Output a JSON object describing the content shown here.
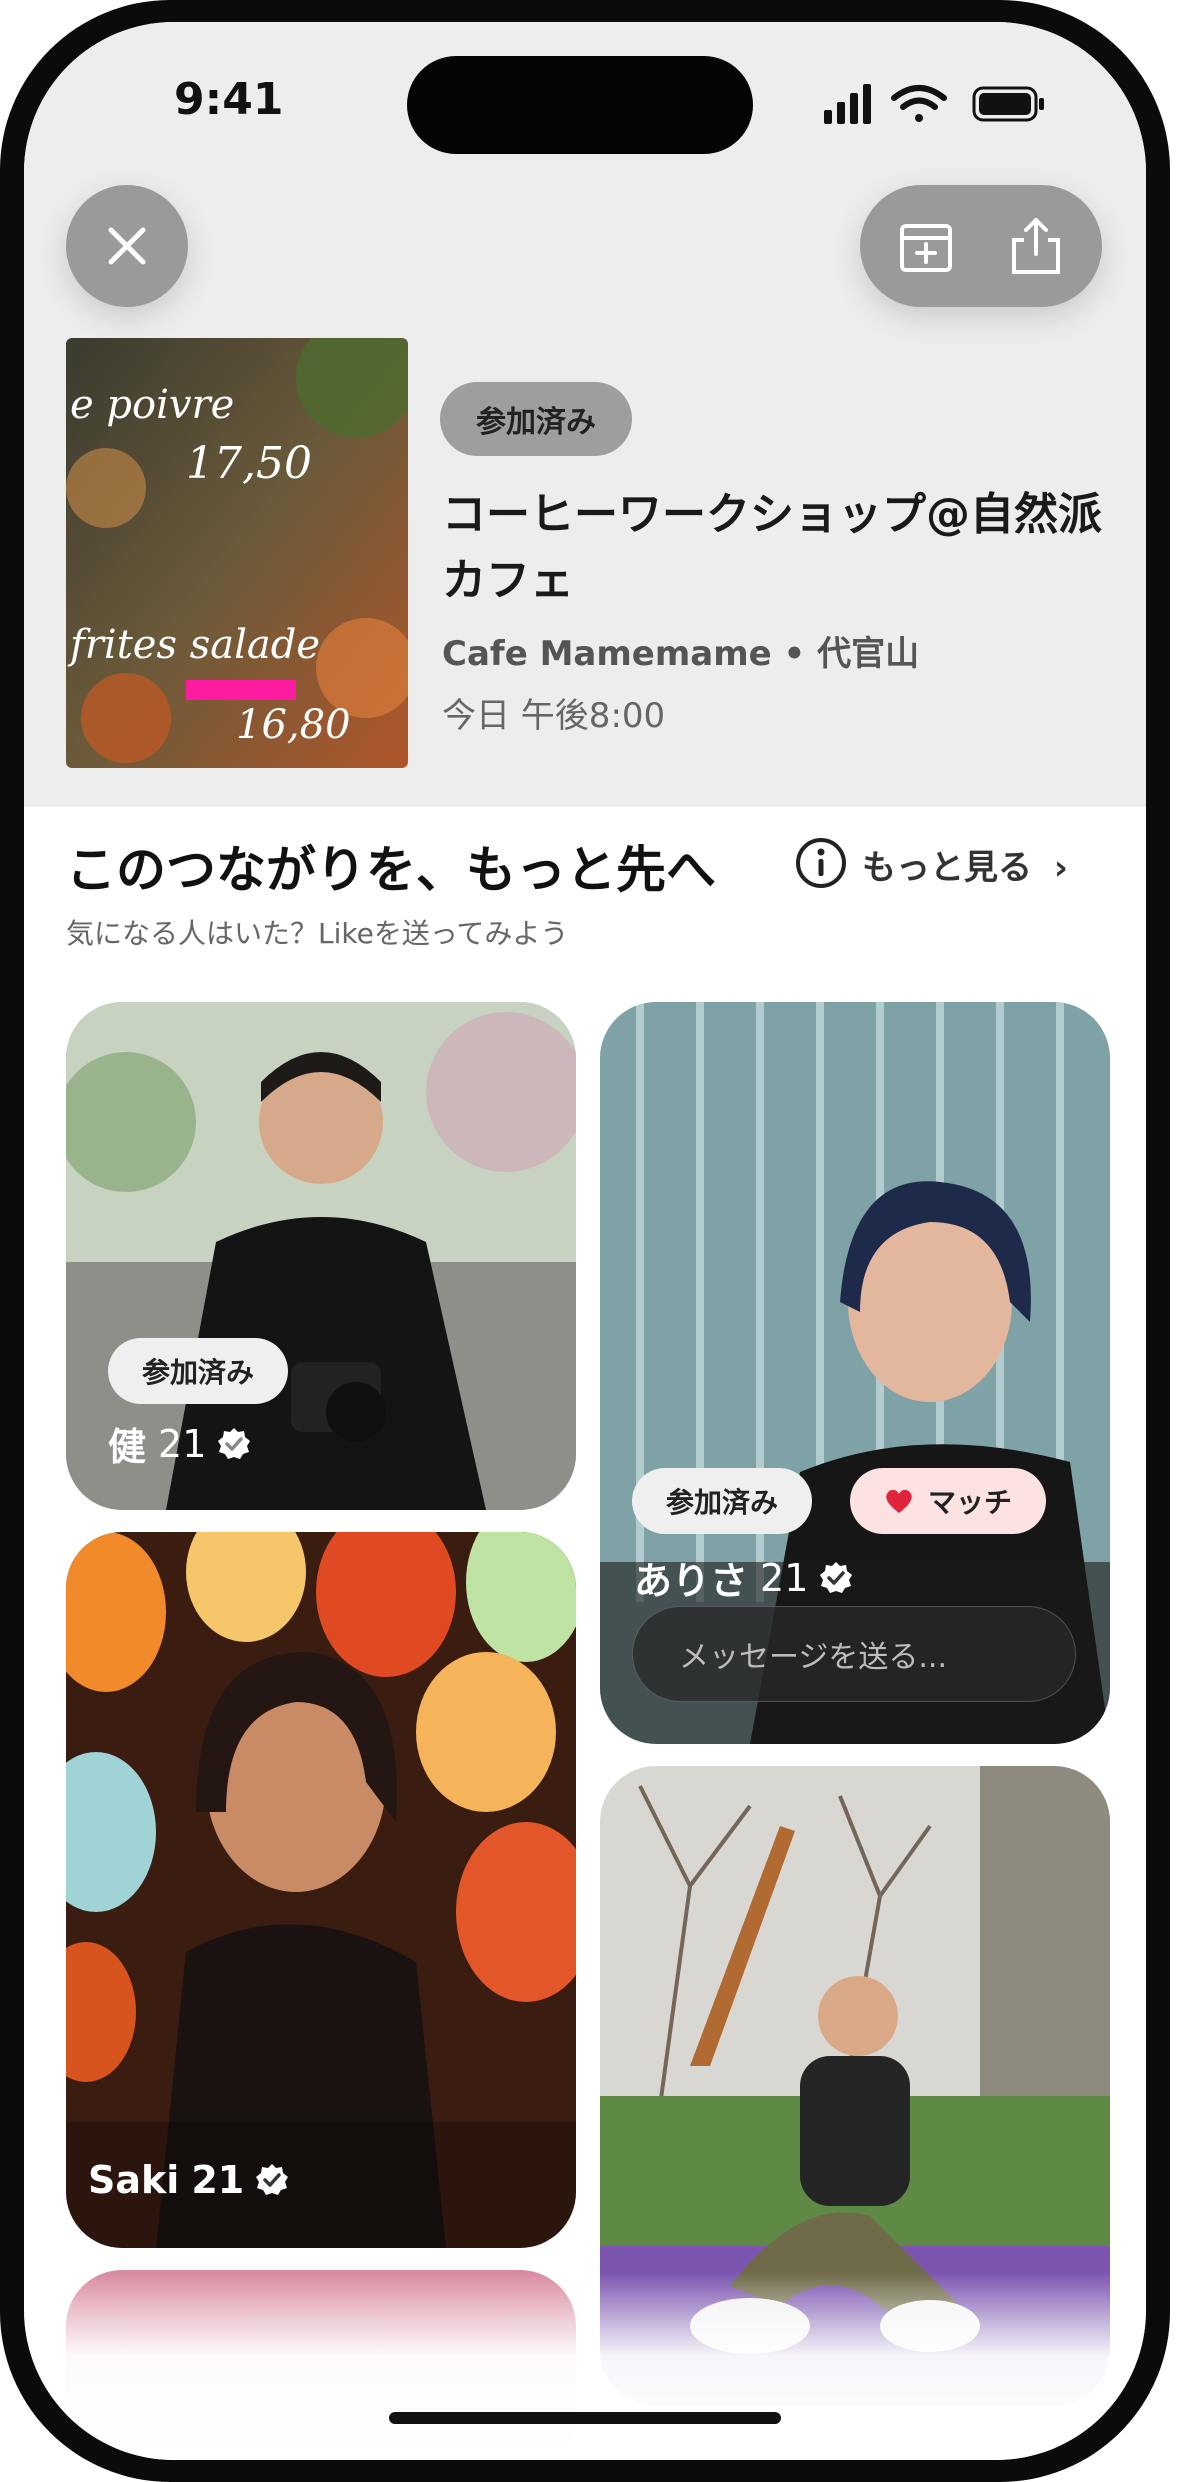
{
  "status_bar": {
    "time": "9:41"
  },
  "event": {
    "badge": "参加済み",
    "title": "コーヒーワークショップ@自然派カフェ",
    "venue": "Cafe Mamemame • 代官山",
    "time": "今日 午後8:00",
    "photo_text": {
      "line1": "e poivre",
      "line2": "17,50",
      "line3": "frites salade",
      "line4": "16,80"
    }
  },
  "section": {
    "title": "このつながりを、もっと先へ",
    "more_label": "もっと見る",
    "subtitle": "気になる人はいた？Likeを送ってみよう"
  },
  "cards": [
    {
      "name": "健",
      "age": "21",
      "badge": "参加済み"
    },
    {
      "name": "ありさ",
      "age": "21",
      "badge": "参加済み",
      "match": "マッチ",
      "message_placeholder": "メッセージを送る..."
    },
    {
      "name": "Saki",
      "age": "21"
    },
    {
      "name": ""
    }
  ],
  "colors": {
    "header_bg": "#ededed",
    "badge_gray": "#9e9e9e",
    "match_pink": "#fde2e2",
    "heart": "#e0243b"
  }
}
